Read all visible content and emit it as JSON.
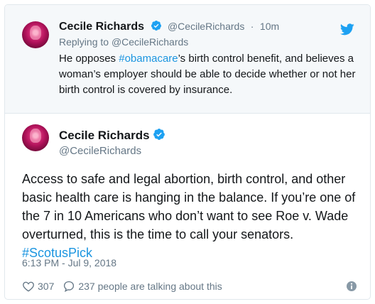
{
  "parent_tweet": {
    "author_name": "Cecile Richards",
    "handle": "@CecileRichards",
    "separator": "·",
    "time_ago": "10m",
    "reply_prefix": "Replying to",
    "reply_to": "@CecileRichards",
    "text_before": "He opposes ",
    "hashtag": "#obamacare",
    "text_after": "’s birth control benefit, and believes a woman’s employer should be able to decide whether or not her birth control is covered by insurance."
  },
  "tweet": {
    "author_name": "Cecile Richards",
    "handle": "@CecileRichards",
    "text": "Access to safe and legal abortion, birth control, and other basic health care is hanging in the balance. If you’re one of the 7 in 10 Americans who don’t want to see Roe v. Wade overturned, this is the time to call your senators.",
    "hashtag": "#ScotusPick",
    "timestamp": "6:13 PM - Jul 9, 2018",
    "likes": "307",
    "talking": "237 people are talking about this"
  },
  "icons": {
    "verified": "verified-badge-icon",
    "twitter": "twitter-bird-icon",
    "like": "heart-icon",
    "reply": "speech-bubble-icon",
    "info": "info-icon"
  },
  "colors": {
    "link": "#1b95e0",
    "secondary_text": "#657786",
    "parent_background": "#f5f8fa",
    "border": "#e1e8ed"
  }
}
